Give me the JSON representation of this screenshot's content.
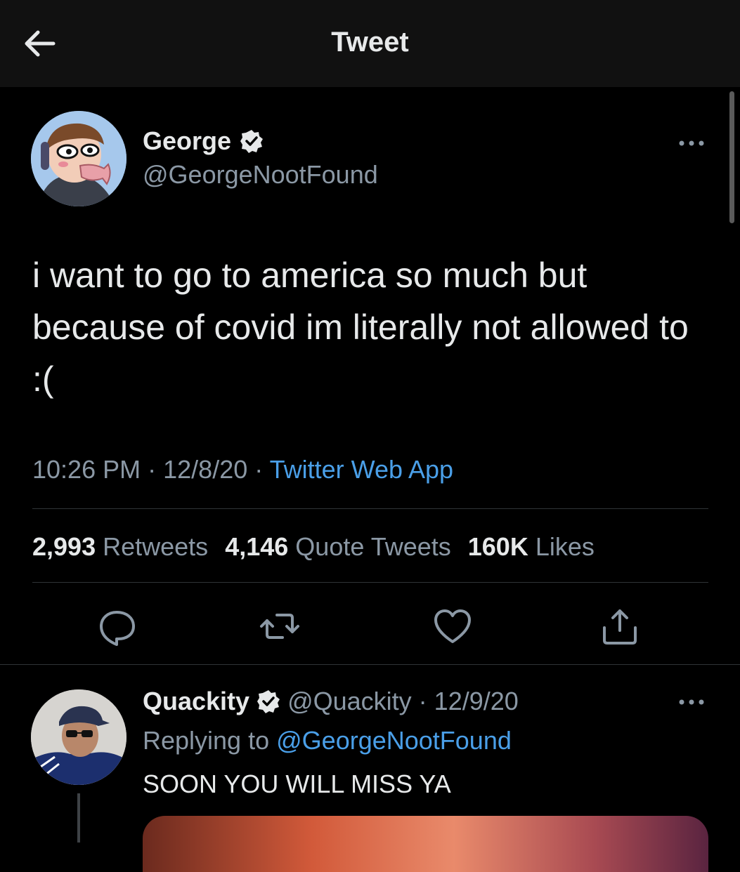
{
  "header": {
    "title": "Tweet"
  },
  "tweet": {
    "display_name": "George",
    "handle": "@GeorgeNootFound",
    "text": "i want to go to america so much but because of covid im literally not allowed to :(",
    "time": "10:26 PM",
    "date": "12/8/20",
    "separator": "·",
    "source": "Twitter Web App",
    "stats": {
      "retweets_count": "2,993",
      "retweets_label": "Retweets",
      "quotes_count": "4,146",
      "quotes_label": "Quote Tweets",
      "likes_count": "160K",
      "likes_label": "Likes"
    }
  },
  "reply": {
    "display_name": "Quackity",
    "handle": "@Quackity",
    "separator": "·",
    "date": "12/9/20",
    "replying_prefix": "Replying to",
    "replying_to": "@GeorgeNootFound",
    "text": "SOON YOU WILL MISS YA"
  },
  "colors": {
    "background": "#000000",
    "link": "#4a9fe8",
    "secondary_text": "#8b98a5",
    "divider": "#2f3336"
  }
}
